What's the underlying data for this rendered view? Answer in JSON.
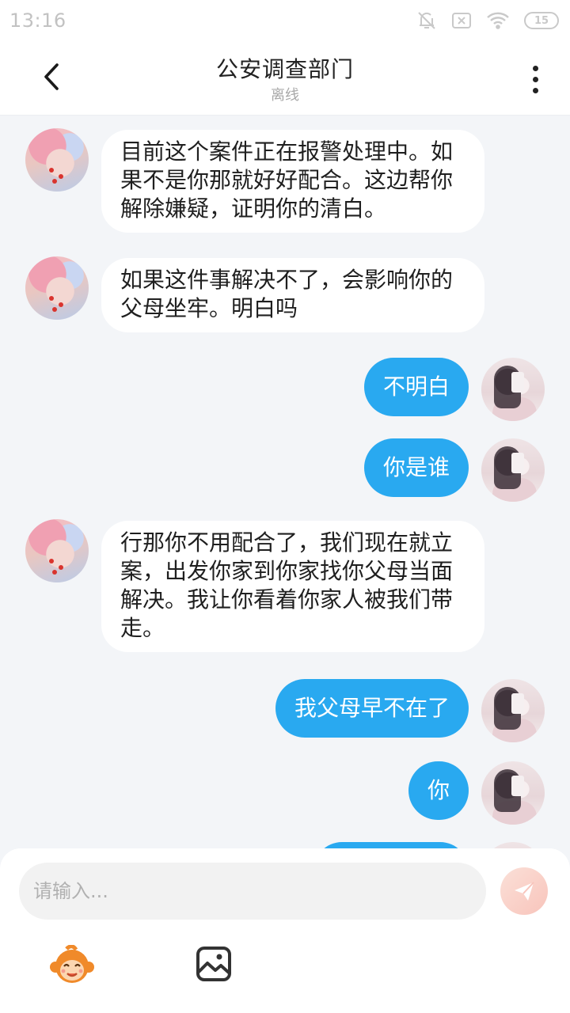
{
  "status_bar": {
    "time": "13:16",
    "battery": "15",
    "icons": [
      "bell-off-icon",
      "sim-off-icon",
      "wifi-icon",
      "battery-icon"
    ]
  },
  "header": {
    "title": "公安调查部门",
    "subtitle": "离线",
    "icons": [
      "back-arrow-icon",
      "more-vertical-icon"
    ]
  },
  "messages": [
    {
      "sender": "other",
      "text": "目前这个案件正在报警处理中。如果不是你那就好好配合。这边帮你解除嫌疑，证明你的清白。"
    },
    {
      "sender": "other",
      "text": "如果这件事解决不了，会影响你的父母坐牢。明白吗"
    },
    {
      "sender": "me",
      "text": "不明白"
    },
    {
      "sender": "me",
      "text": "你是谁"
    },
    {
      "sender": "other",
      "text": "行那你不用配合了，我们现在就立案，出发你家到你家找你父母当面解决。我让你看着你家人被我们带走。"
    },
    {
      "sender": "me",
      "text": "我父母早不在了"
    },
    {
      "sender": "me",
      "text": "你"
    }
  ],
  "composer": {
    "input_value": "",
    "placeholder": "请输入...",
    "icons": [
      "send-icon",
      "monkey-emoji-icon",
      "image-icon"
    ]
  },
  "colors": {
    "my_bubble": "#29a9f0",
    "other_bubble": "#ffffff",
    "background": "#f3f5f8",
    "send_button": "#f8c4bb"
  }
}
